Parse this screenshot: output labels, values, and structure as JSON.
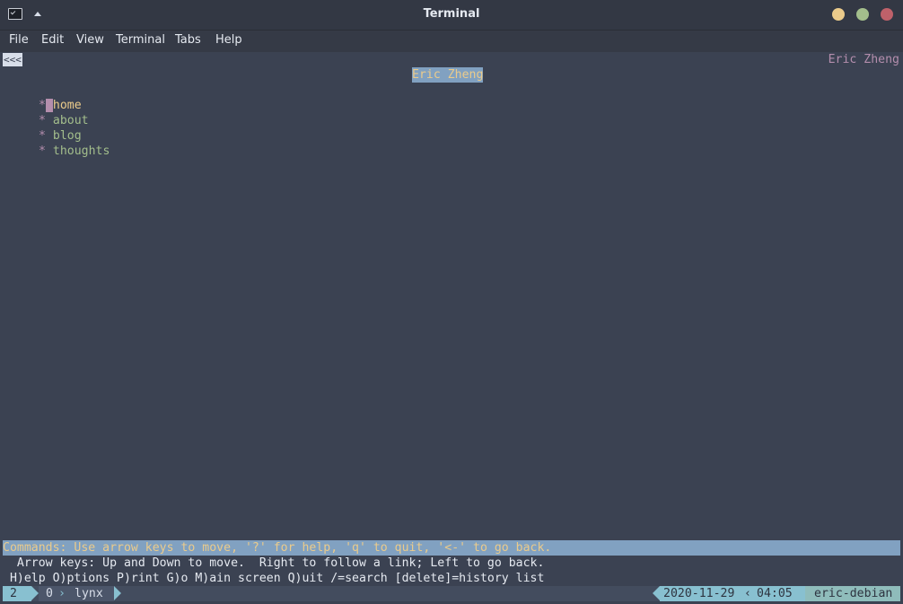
{
  "window": {
    "title": "Terminal"
  },
  "menubar": {
    "items": [
      "File",
      "Edit",
      "View",
      "Terminal",
      "Tabs",
      "Help"
    ]
  },
  "lynx": {
    "back_label": "<<<",
    "site_name_right": "Eric Zheng",
    "page_title": "Eric Zheng",
    "bullet": "*",
    "nav_items": [
      "home",
      "about",
      "blog",
      "thoughts"
    ],
    "commands_line": "Commands: Use arrow keys to move, '?' for help, 'q' to quit, '<-' to go back.",
    "hint_line_1": "  Arrow keys: Up and Down to move.  Right to follow a link; Left to go back.",
    "hint_line_2": " H)elp O)ptions P)rint G)o M)ain screen Q)uit /=search [delete]=history list"
  },
  "tmux": {
    "session": "2",
    "window_index": "0",
    "window_name": "lynx",
    "date": "2020-11-29",
    "time": "04:05",
    "host": "eric-debian"
  },
  "colors": {
    "background": "#3b4252",
    "accent": "#81a1c1",
    "link": "#a3be8c",
    "highlight": "#ebcb8b",
    "magenta": "#b48ead",
    "status_accent": "#88c0d0"
  }
}
